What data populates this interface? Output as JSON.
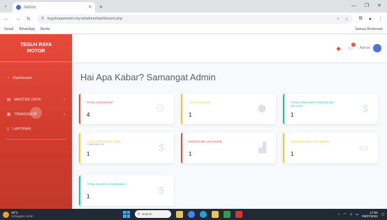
{
  "browser": {
    "tab_title": "Admin",
    "url": "teguhrayamotor.my.id/admin/dashboard.php",
    "bookmarks": [
      "Gmail",
      "WhatsApp",
      "Berita"
    ],
    "all_bookmarks": "Semua Bookmark"
  },
  "sidebar": {
    "brand_line1": "TEGUH RAYA",
    "brand_line2": "MOTOR",
    "items": [
      {
        "label": "Dashboard"
      },
      {
        "label": "MASTER DATA"
      },
      {
        "label": "TRANSAKSI"
      },
      {
        "label": "LAPORAN"
      }
    ]
  },
  "topbar": {
    "alert_count": "",
    "message_count": "1",
    "username": "Admin"
  },
  "heading": "Hai Apa Kabar? Samangat Admin",
  "cards": [
    {
      "label": "TOTAL USER/KASIR",
      "sub": "",
      "value": "4",
      "color": "#e74a3b",
      "icon": "users-icon"
    },
    {
      "label": "TOTAL PRODUK",
      "sub": "",
      "value": "1",
      "color": "#f6c23e",
      "icon": "box-icon"
    },
    {
      "label": "TOTAL TRANSAKSI PENJUALAN SELESAI",
      "sub": "",
      "value": "1",
      "color": "#1cc88a",
      "icon": "dollar-icon"
    },
    {
      "label": "TOTAL TRANSAKSI TIDAK",
      "sub": "LUNAS/BELUM",
      "value": "1",
      "color": "#f6c23e",
      "icon": "dollar-icon"
    },
    {
      "label": "BARANG BELUM DIKIRIM",
      "sub": "",
      "value": "1",
      "color": "#e74a3b",
      "icon": "truck-icon"
    },
    {
      "label": "TRANSAKSI BELUM DIBAYAR",
      "sub": "",
      "value": "1",
      "color": "#f6c23e",
      "icon": "money-icon"
    },
    {
      "label": "TOTAL SELURUH TRANSAKSI",
      "sub": "",
      "value": "1",
      "color": "#1cc88a",
      "icon": "dollar-icon"
    }
  ],
  "taskbar": {
    "weather_temp": "29°C",
    "weather_desc": "Sebagian cerah",
    "search": "Search",
    "time": "17:05",
    "date": "05/07/2024"
  }
}
